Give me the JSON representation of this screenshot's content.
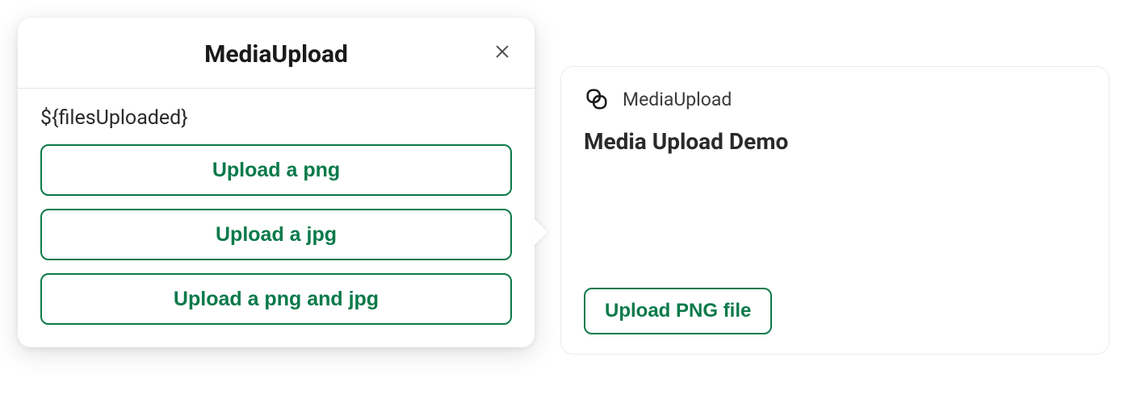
{
  "popover": {
    "title": "MediaUpload",
    "files_uploaded_label": "${filesUploaded}",
    "buttons": [
      {
        "label": "Upload a png"
      },
      {
        "label": "Upload a jpg"
      },
      {
        "label": "Upload a png and jpg"
      }
    ]
  },
  "card": {
    "icon_name": "link-icon",
    "subtitle": "MediaUpload",
    "title": "Media Upload Demo",
    "button_label": "Upload PNG file"
  },
  "colors": {
    "accent": "#0a7a4a",
    "text_primary": "#1a1a1a",
    "text_secondary": "#3a3a3a",
    "border": "#e5e5e5"
  }
}
